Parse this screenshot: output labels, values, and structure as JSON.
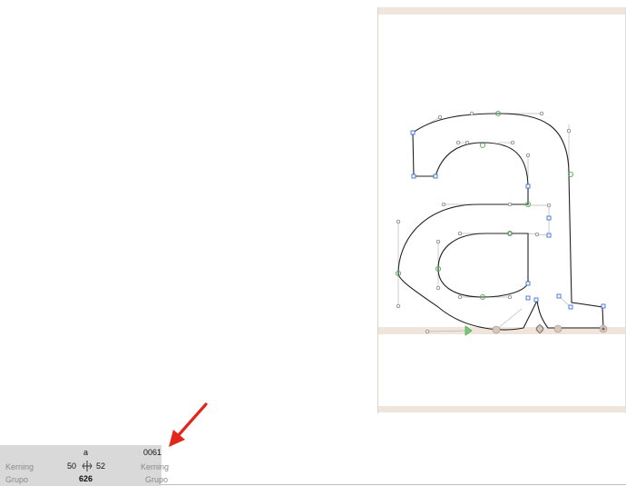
{
  "glyph_panel": {
    "glyph_name": "a",
    "unicode": "0061",
    "kerning_label_left": "Kerning",
    "kerning_label_right": "Kerning",
    "left_value": "50",
    "right_value": "52",
    "group_label_left": "Grupo",
    "group_label_right": "Grupo",
    "width_value": "626"
  },
  "colors": {
    "metrics_band": "#efe5dc",
    "panel_bg": "#d9d9d9",
    "outline": "#222222",
    "oncurve_smooth": "#4caf50",
    "oncurve_corner": "#3a6fd8",
    "annotation_arrow": "#e3261b"
  },
  "icons": [
    "kerning-icon",
    "annotation-arrow-icon"
  ]
}
